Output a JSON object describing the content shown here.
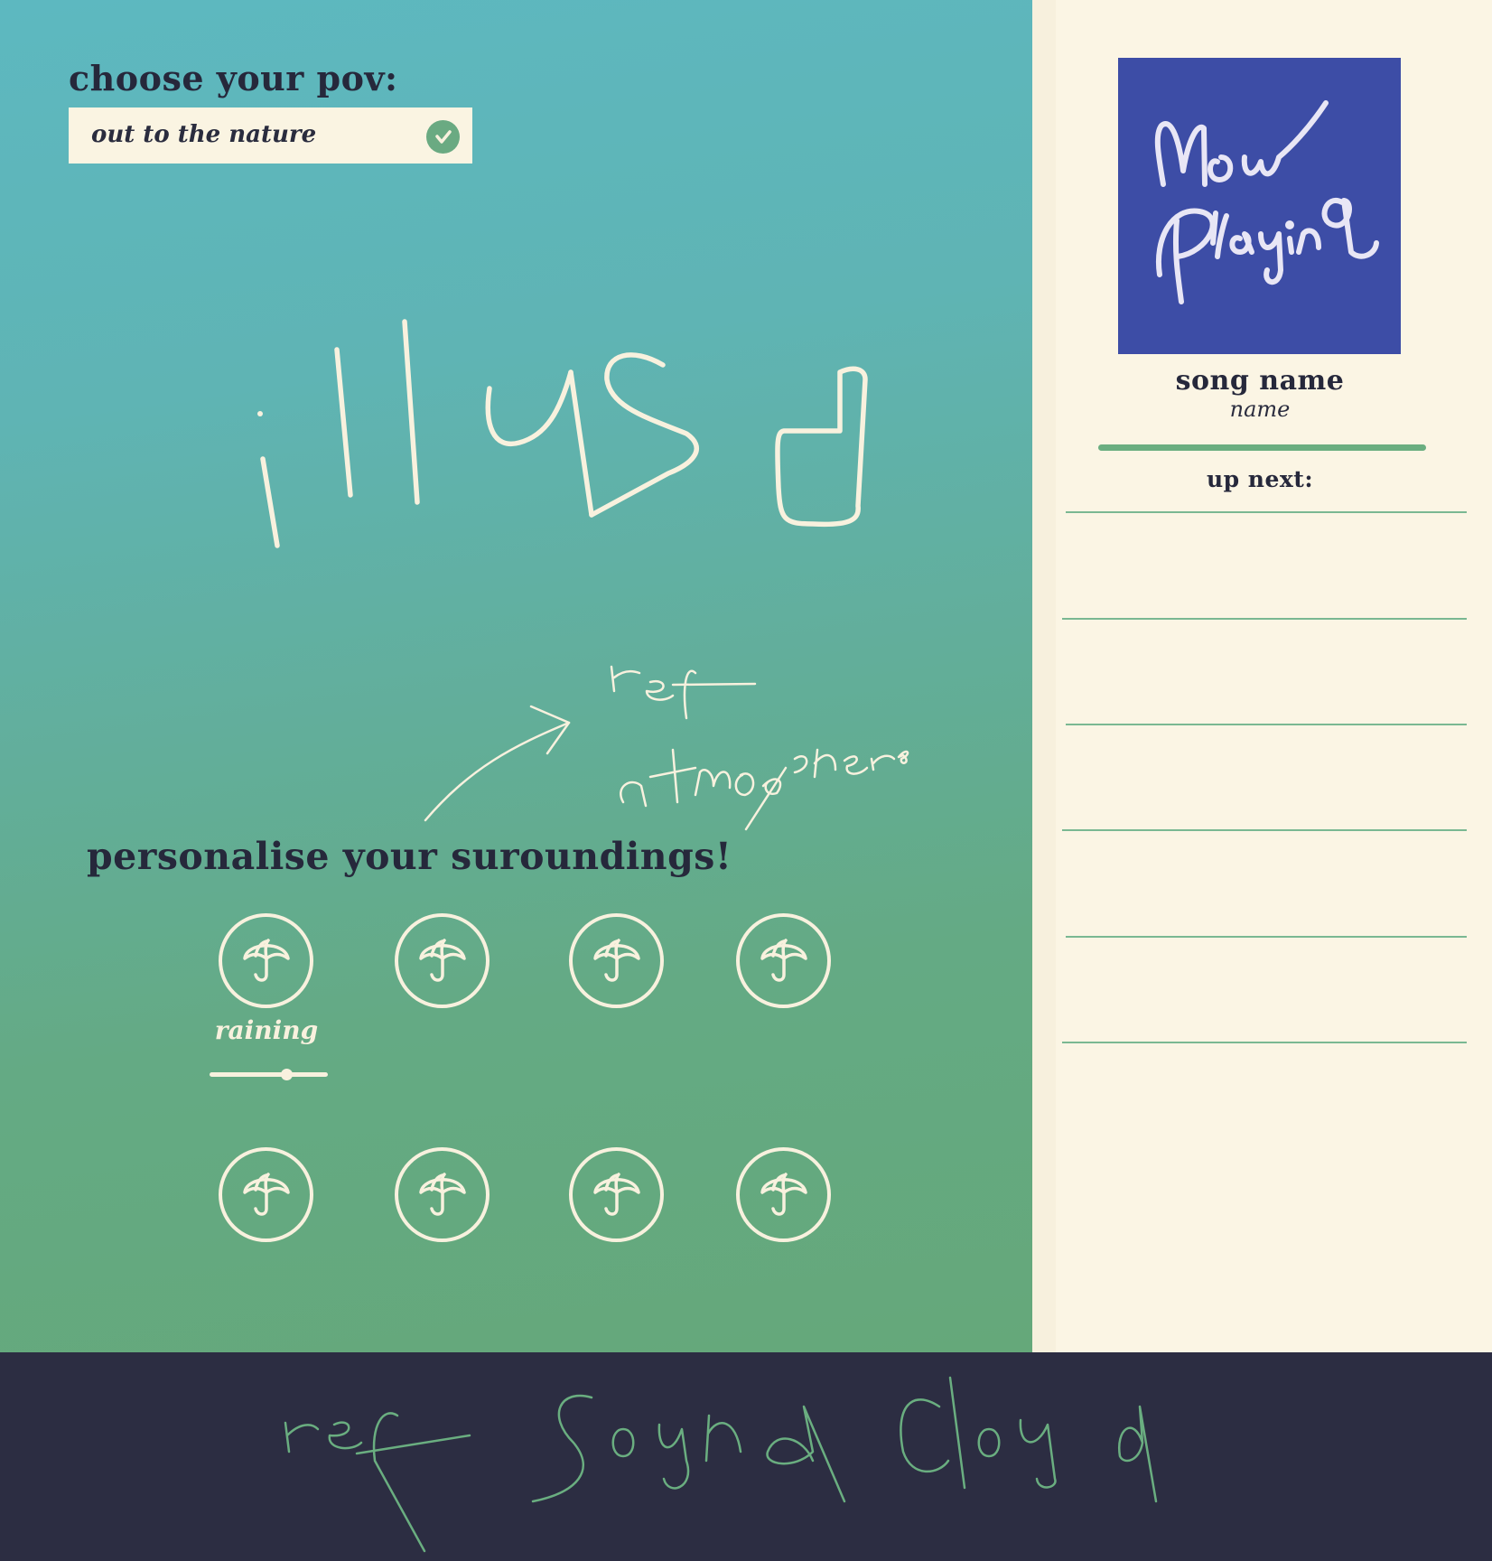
{
  "pov": {
    "title": "choose your pov:",
    "selected": "out to the nature",
    "check_icon": "check-circle-icon",
    "check_color": "#6aaa82"
  },
  "sketch_notes": {
    "illustration": "illusd",
    "ref_atmosphere": "ref atmosphere",
    "ref_soundcloud": "ref soundcloud"
  },
  "surroundings": {
    "title": "personalise your suroundings!",
    "icon": "umbrella-icon",
    "active_label": "raining",
    "volume": 0.65,
    "button_count": 8
  },
  "now_playing": {
    "album_art_text": "Now Playing",
    "album_art_color": "#3d4da6",
    "song_title": "song name",
    "artist": "name",
    "progress": 1.0,
    "accent": "#6aae80"
  },
  "up_next": {
    "title": "up next:",
    "items": [
      "",
      "",
      "",
      "",
      ""
    ]
  },
  "colors": {
    "background_top": "#5db8c0",
    "background_bottom": "#65a87a",
    "sidebar": "#fbf5e4",
    "footer": "#2c2d42",
    "text": "#26283b"
  }
}
